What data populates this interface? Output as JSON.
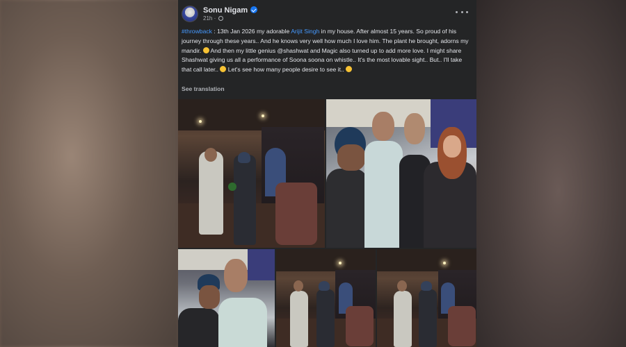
{
  "post": {
    "author": "Sonu Nigam",
    "verified": true,
    "time": "21h",
    "privacy_icon": "globe-icon",
    "menu_icon": "more-horizontal-icon",
    "caption": {
      "hashtag": "#throwback",
      "part1": " : 13th Jan 2026 my adorable ",
      "mention": "Arijit Singh",
      "part2": "  in my house. After almost 15 years. So proud of his journey through these years.. And he knows very well how much I love him. The plant he brought, adorns my mandir. ",
      "part3": " And then my little genius @shashwat and Magic also turned up to add more love. I might share Shashwat giving us all a performance of Soona soona on whistle.. It's the most lovable sight.. But.. I'll take that call later.. ",
      "part4": " Let's see how many people desire to see it.. "
    },
    "see_translation": "See translation"
  },
  "colors": {
    "card_bg": "#242526",
    "text": "#e4e6eb",
    "secondary_text": "#b0b3b8",
    "link": "#4599ff",
    "verified_badge": "#1877f2"
  }
}
